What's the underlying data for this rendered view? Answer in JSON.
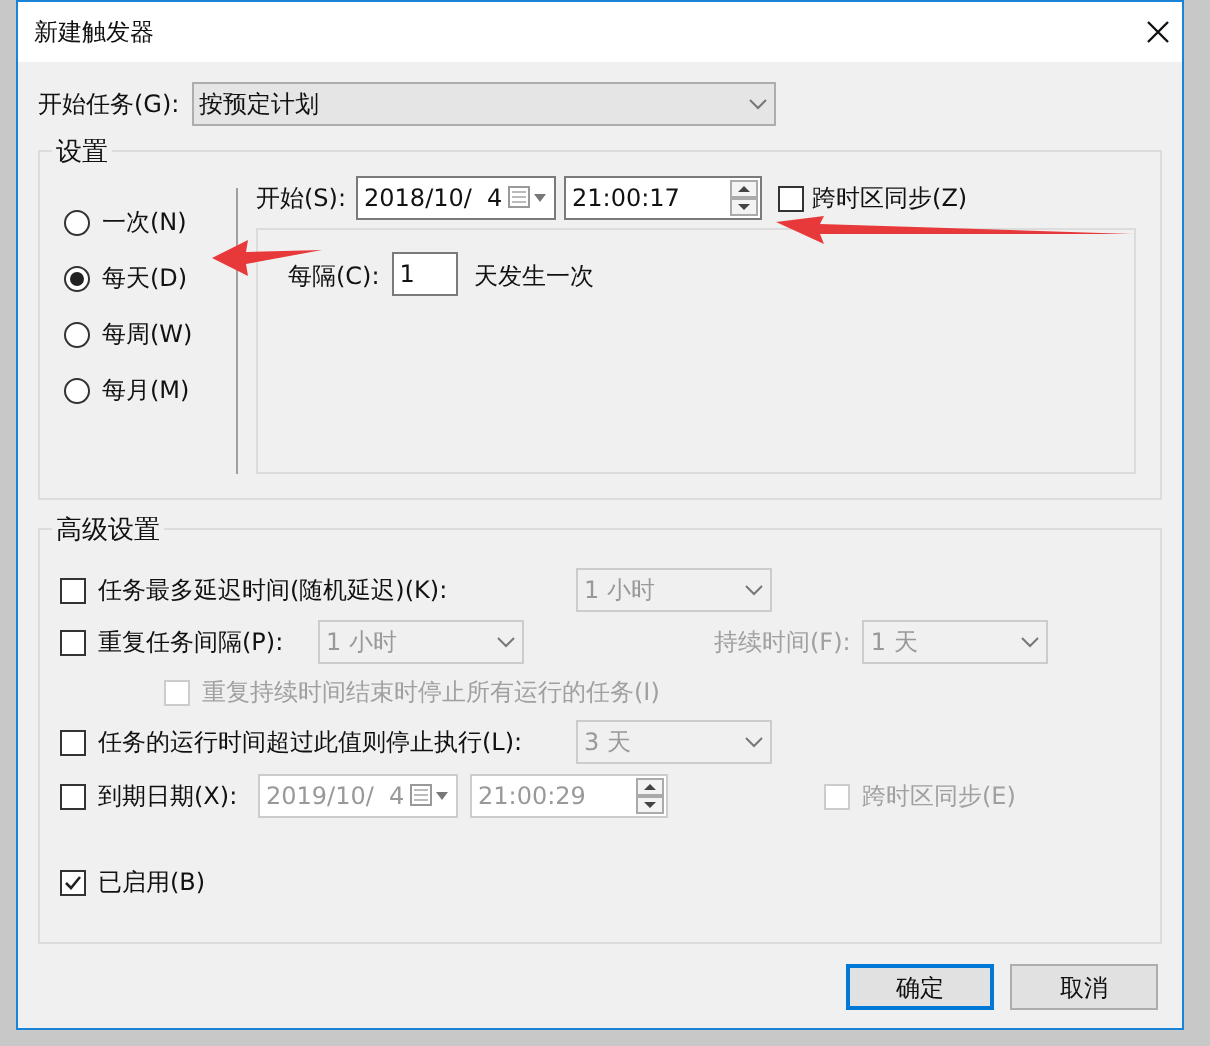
{
  "window": {
    "title": "新建触发器"
  },
  "start_task": {
    "label": "开始任务(G):",
    "value": "按预定计划"
  },
  "settings": {
    "title": "设置",
    "frequencies": [
      {
        "label": "一次(N)",
        "selected": false
      },
      {
        "label": "每天(D)",
        "selected": true
      },
      {
        "label": "每周(W)",
        "selected": false
      },
      {
        "label": "每月(M)",
        "selected": false
      }
    ],
    "start": {
      "label": "开始(S):",
      "date": "2018/10/  4",
      "time": "21:00:17",
      "sync_timezone": {
        "label": "跨时区同步(Z)",
        "checked": false
      }
    },
    "recur": {
      "label": "每隔(C):",
      "value": "1",
      "suffix": "天发生一次"
    }
  },
  "advanced": {
    "title": "高级设置",
    "delay": {
      "label": "任务最多延迟时间(随机延迟)(K):",
      "checked": false,
      "value": "1 小时",
      "disabled": true
    },
    "repeat": {
      "label": "重复任务间隔(P):",
      "checked": false,
      "value": "1 小时",
      "disabled": true,
      "duration_label": "持续时间(F):",
      "duration_value": "1 天",
      "stop_all": {
        "label": "重复持续时间结束时停止所有运行的任务(I)",
        "checked": false
      }
    },
    "stop_after": {
      "label": "任务的运行时间超过此值则停止执行(L):",
      "checked": false,
      "value": "3 天",
      "disabled": true
    },
    "expire": {
      "label": "到期日期(X):",
      "checked": false,
      "date": "2019/10/  4",
      "time": "21:00:29",
      "disabled": true,
      "sync_timezone": {
        "label": "跨时区同步(E)",
        "checked": false
      }
    },
    "enabled": {
      "label": "已启用(B)",
      "checked": true
    }
  },
  "buttons": [
    {
      "label": "确定",
      "focused": true
    },
    {
      "label": "取消",
      "focused": false
    }
  ]
}
